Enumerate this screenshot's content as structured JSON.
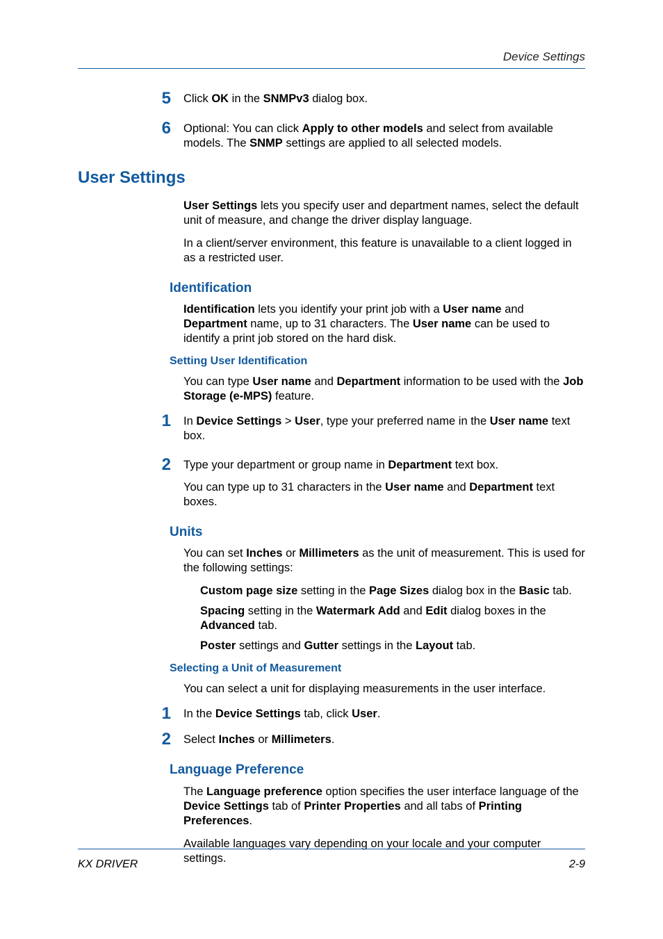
{
  "header": {
    "section": "Device Settings"
  },
  "footer": {
    "left": "KX DRIVER",
    "right": "2-9"
  },
  "s5": {
    "num": "5",
    "pre": "Click ",
    "b1": "OK",
    "mid": " in the ",
    "b2": "SNMPv3",
    "post": " dialog box."
  },
  "s6": {
    "num": "6",
    "pre": "Optional: You can click ",
    "b1": "Apply to other models",
    "mid": " and select from available models. The ",
    "b2": "SNMP",
    "post": " settings are applied to all selected models."
  },
  "h1": "User Settings",
  "us": {
    "p1a": "User Settings",
    "p1b": " lets you specify user and department names, select the default unit of measure, and change the driver display language.",
    "p2": "In a client/server environment, this feature is unavailable to a client logged in as a restricted user."
  },
  "ident": {
    "h": "Identification",
    "b1": "Identification",
    "t1": " lets you identify your print job with a ",
    "b2": "User name",
    "t2": " and ",
    "b3": "Department",
    "t3": " name, up to 31 characters. The ",
    "b4": "User name",
    "t4": " can be used to identify a print job stored on the hard disk."
  },
  "sui": {
    "h": "Setting User Identification",
    "t1": "You can type ",
    "b1": "User name",
    "t2": " and ",
    "b2": "Department",
    "t3": " information to be used with the ",
    "b3": "Job Storage (e-MPS)",
    "t4": " feature."
  },
  "sui1": {
    "num": "1",
    "t1": "In ",
    "b1": "Device Settings",
    "gt": " > ",
    "b2": "User",
    "t2": ", type your preferred name in the ",
    "b3": "User name",
    "t3": " text box."
  },
  "sui2": {
    "num": "2",
    "t1": "Type your department or group name in ",
    "b1": "Department",
    "t2": " text box."
  },
  "sui_note": {
    "t1": "You can type up to 31 characters in the ",
    "b1": "User name",
    "t2": " and ",
    "b2": "Department",
    "t3": " text boxes."
  },
  "units": {
    "h": "Units",
    "t1": "You can set ",
    "b1": "Inches",
    "t2": " or ",
    "b2": "Millimeters",
    "t3": " as the unit of measurement. This is used for the following settings:"
  },
  "u_li1": {
    "b1": "Custom page size",
    "t1": " setting in the ",
    "b2": "Page Sizes",
    "t2": " dialog box in the ",
    "b3": "Basic",
    "t3": " tab."
  },
  "u_li2": {
    "b1": "Spacing",
    "t1": " setting in the ",
    "b2": "Watermark Add",
    "t2": " and ",
    "b3": "Edit",
    "t3": " dialog boxes in the ",
    "b4": "Advanced",
    "t4": " tab."
  },
  "u_li3": {
    "b1": "Poster",
    "t1": " settings and ",
    "b2": "Gutter",
    "t2": " settings in the ",
    "b3": "Layout",
    "t3": " tab."
  },
  "suom": {
    "h": "Selecting a Unit of Measurement",
    "p": "You can select a unit for displaying measurements in the user interface."
  },
  "suom1": {
    "num": "1",
    "t1": "In the ",
    "b1": "Device Settings",
    "t2": " tab, click ",
    "b2": "User",
    "t3": "."
  },
  "suom2": {
    "num": "2",
    "t1": "Select ",
    "b1": "Inches",
    "t2": " or ",
    "b2": "Millimeters",
    "t3": "."
  },
  "lang": {
    "h": "Language Preference",
    "t1": "The ",
    "b1": "Language preference",
    "t2": " option specifies the user interface language of the ",
    "b2": "Device Settings",
    "t3": " tab of ",
    "b3": "Printer Properties",
    "t4": " and all tabs of ",
    "b4": "Printing Preferences",
    "t5": ".",
    "p2": "Available languages vary depending on your locale and your computer settings."
  }
}
